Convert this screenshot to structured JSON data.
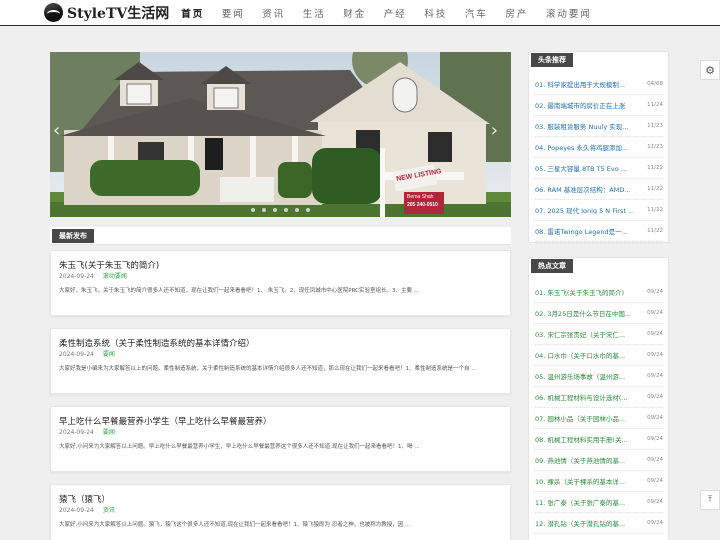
{
  "site": {
    "name": "StyleTV生活网"
  },
  "nav": [
    "首页",
    "要闻",
    "资讯",
    "生活",
    "财金",
    "产经",
    "科技",
    "汽车",
    "房产",
    "滚动要闻"
  ],
  "banner": {
    "sign_text": "NEW LISTING",
    "agent_name": "Berna Shah",
    "agent_phone": "205 240-0510"
  },
  "latest": {
    "heading": "最新发布",
    "posts": [
      {
        "title": "朱玉飞(关于朱玉飞的简介)",
        "date": "2024-09-24",
        "category": "滚动要闻",
        "excerpt": "大家好，朱玉飞，关于朱玉飞的简介很多人还不知道，现在让我们一起来看看吧！1、 朱玉飞。2、现任凤城市中心医院PRC实验室组长。3、主要 ..."
      },
      {
        "title": "柔性制造系统（关于柔性制造系统的基本详情介绍）",
        "date": "2024-09-24",
        "category": "要闻",
        "excerpt": "大家好我是小编来为大家解答以上的问题。柔性制造系统，关于柔性制造系统的基本详情介绍很多人还不知道，那么现在让我们一起来看看吧！1、柔性制造系统是一个自 ..."
      },
      {
        "title": "早上吃什么早餐最营养小学生（早上吃什么早餐最营养）",
        "date": "2024-09-24",
        "category": "要闻",
        "excerpt": "大家好,小问来为大家解答以上问题。早上吃什么早餐最营养小学生，早上吃什么早餐最营养这个很多人还不知道,现在让我们一起来看看吧！1、喝 ..."
      },
      {
        "title": "猿飞（猿飞）",
        "date": "2024-09-24",
        "category": "资讯",
        "excerpt": "大家好,小问来为大家解答以上问题。猿飞，猿飞这个很多人还不知道,现在让我们一起来看看吧！1、猿飞猿即为 忍者之神，也被称为教授，因 ..."
      }
    ]
  },
  "top": {
    "heading": "头条推荐",
    "items": [
      {
        "no": "01.",
        "text": "科学家提出用于大规模制...",
        "date": "04/08"
      },
      {
        "no": "02.",
        "text": "最南端城市的房价正在上涨",
        "date": "11/24"
      },
      {
        "no": "03.",
        "text": "服装租赁服务 Nuuly 实现...",
        "date": "11/23"
      },
      {
        "no": "04.",
        "text": "Popeyes 永久将鸡腿添加...",
        "date": "11/23"
      },
      {
        "no": "05.",
        "text": "三星大容量 8TB T5 Evo ...",
        "date": "11/22"
      },
      {
        "no": "06.",
        "text": "RAM 基准层次结构：AMD...",
        "date": "11/22"
      },
      {
        "no": "07.",
        "text": "2025 现代 Ioniq 5 N First ...",
        "date": "11/22"
      },
      {
        "no": "08.",
        "text": "雷诺Twingo Legend是一...",
        "date": "11/22"
      }
    ]
  },
  "hot": {
    "heading": "热点文章",
    "items": [
      {
        "no": "01.",
        "text": "朱玉飞(关于朱玉飞的简介)",
        "date": "09/24"
      },
      {
        "no": "02.",
        "text": "3月25日是什么节日在中国...",
        "date": "09/24"
      },
      {
        "no": "03.",
        "text": "宋仁宗张贵妃（关于宋仁...",
        "date": "09/24"
      },
      {
        "no": "04.",
        "text": "口水巾（关于口水巾的基...",
        "date": "09/24"
      },
      {
        "no": "05.",
        "text": "温州游乐场事故（温州游...",
        "date": "09/24"
      },
      {
        "no": "06.",
        "text": "机械工程材料与设计选材(...",
        "date": "09/24"
      },
      {
        "no": "07.",
        "text": "园林小品（关于园林小品...",
        "date": "09/24"
      },
      {
        "no": "08.",
        "text": "机械工程材料实用手册(关...",
        "date": "09/24"
      },
      {
        "no": "09.",
        "text": "燕池情（关于燕池情的基...",
        "date": "09/24"
      },
      {
        "no": "10.",
        "text": "裸杀（关于裸杀的基本详...",
        "date": "09/24"
      },
      {
        "no": "11.",
        "text": "张广泰（关于张广泰的基...",
        "date": "09/24"
      },
      {
        "no": "12.",
        "text": "潜孔钻（关于潜孔钻的基...",
        "date": "09/24"
      }
    ]
  },
  "icons": {
    "settings": "gear-icon",
    "back_to_top": "arrow-up-icon",
    "prev": "chevron-left-icon",
    "next": "chevron-right-icon",
    "logo": "tv-logo-icon"
  },
  "colors": {
    "tag_bg": "#484848",
    "link_blue": "#1f6fb0",
    "link_green": "#2a8a3a",
    "category_green": "#28a745"
  }
}
